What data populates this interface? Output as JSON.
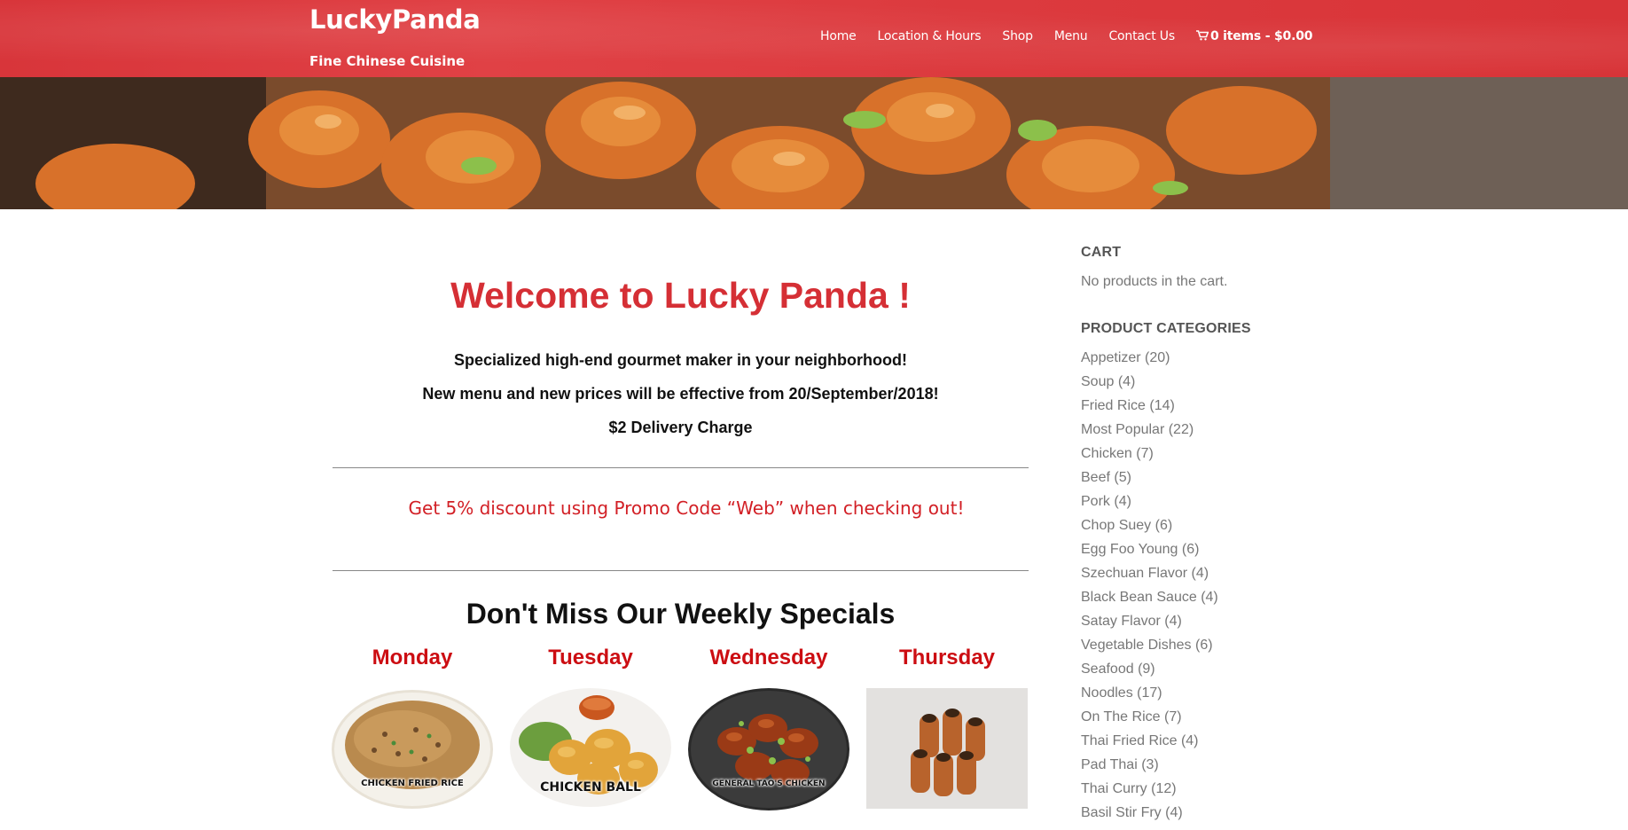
{
  "header": {
    "site_title": "LuckyPanda",
    "tagline": "Fine Chinese Cuisine",
    "nav": [
      {
        "label": "Home"
      },
      {
        "label": "Location & Hours"
      },
      {
        "label": "Shop"
      },
      {
        "label": "Menu"
      },
      {
        "label": "Contact Us"
      }
    ],
    "cart_label": "0 items - $0.00",
    "brand_color": "#d8353a"
  },
  "main": {
    "welcome": "Welcome to Lucky Panda !",
    "intro_lines": [
      "Specialized high-end gourmet maker in your neighborhood!",
      "New menu and new prices will be effective from 20/September/2018!",
      "$2 Delivery Charge"
    ],
    "promo": "Get 5% discount using Promo Code “Web” when checking out!",
    "specials_title": "Don't Miss Our Weekly Specials",
    "specials": [
      {
        "day": "Monday",
        "dish_label": "CHICKEN FRIED RICE"
      },
      {
        "day": "Tuesday",
        "dish_label": "CHICKEN BALL"
      },
      {
        "day": "Wednesday",
        "dish_label": "GENERAL TAO'S CHICKEN"
      },
      {
        "day": "Thursday",
        "dish_label": ""
      }
    ]
  },
  "sidebar": {
    "cart_heading": "CART",
    "cart_empty": "No products in the cart.",
    "categories_heading": "PRODUCT CATEGORIES",
    "categories": [
      {
        "name": "Appetizer",
        "count": "(20)"
      },
      {
        "name": "Soup",
        "count": "(4)"
      },
      {
        "name": "Fried Rice",
        "count": "(14)"
      },
      {
        "name": "Most Popular",
        "count": "(22)"
      },
      {
        "name": "Chicken",
        "count": "(7)"
      },
      {
        "name": "Beef",
        "count": "(5)"
      },
      {
        "name": "Pork",
        "count": "(4)"
      },
      {
        "name": "Chop Suey",
        "count": "(6)"
      },
      {
        "name": "Egg Foo Young",
        "count": "(6)"
      },
      {
        "name": "Szechuan Flavor",
        "count": "(4)"
      },
      {
        "name": "Black Bean Sauce",
        "count": "(4)"
      },
      {
        "name": "Satay Flavor",
        "count": "(4)"
      },
      {
        "name": "Vegetable Dishes",
        "count": "(6)"
      },
      {
        "name": "Seafood",
        "count": "(9)"
      },
      {
        "name": "Noodles",
        "count": "(17)"
      },
      {
        "name": "On The Rice",
        "count": "(7)"
      },
      {
        "name": "Thai Fried Rice",
        "count": "(4)"
      },
      {
        "name": "Pad Thai",
        "count": "(3)"
      },
      {
        "name": "Thai Curry",
        "count": "(12)"
      },
      {
        "name": "Basil Stir Fry",
        "count": "(4)"
      }
    ]
  }
}
